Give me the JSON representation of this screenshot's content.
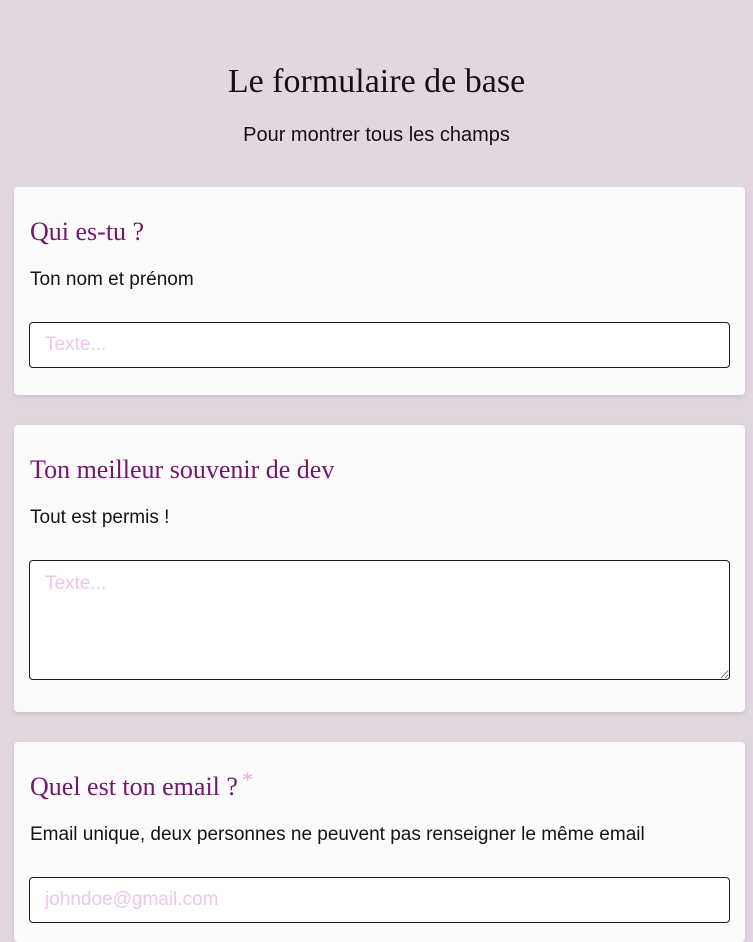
{
  "header": {
    "title": "Le formulaire de base",
    "subtitle": "Pour montrer tous les champs"
  },
  "questions": [
    {
      "title": "Qui es-tu ?",
      "description": "Ton nom et prénom",
      "placeholder": "Texte...",
      "required": false,
      "input_type": "text"
    },
    {
      "title": "Ton meilleur souvenir de dev",
      "description": "Tout est permis !",
      "placeholder": "Texte...",
      "required": false,
      "input_type": "textarea"
    },
    {
      "title": "Quel est ton email ?",
      "required_mark": "*",
      "description": "Email unique, deux personnes ne peuvent pas renseigner le même email",
      "placeholder": "johndoe@gmail.com",
      "required": true,
      "input_type": "email"
    }
  ],
  "colors": {
    "background": "#e2d7e1",
    "card": "#fbfbfb",
    "question_title": "#74156f",
    "placeholder": "#f0c4ee",
    "required_mark": "#e9a9e3"
  }
}
